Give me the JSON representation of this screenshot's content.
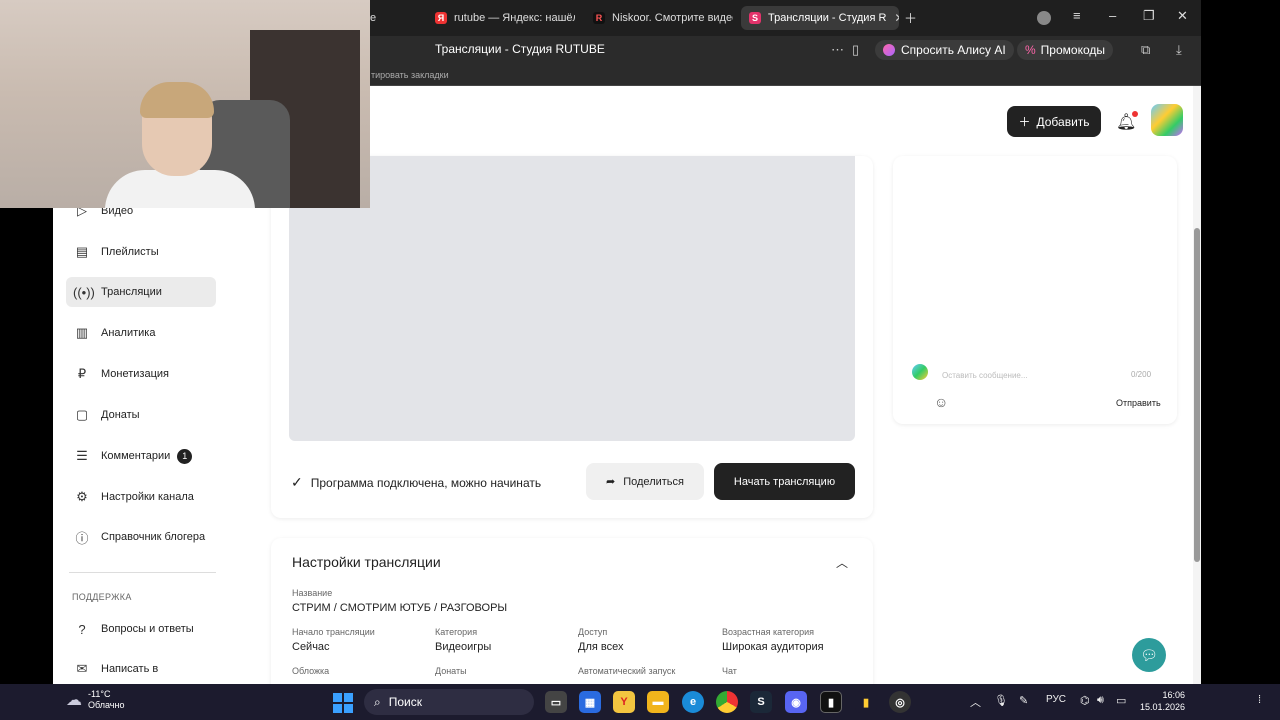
{
  "browser": {
    "tabs": [
      {
        "label": "е",
        "icon": "tab-fragment"
      },
      {
        "label": "rutube — Яндекс: нашёлс",
        "icon": "yandex-icon"
      },
      {
        "label": "Niskoor. Смотрите видео",
        "icon": "rutube-icon"
      },
      {
        "label": "Трансляции - Студия R",
        "icon": "rutube-studio-icon",
        "active": true
      }
    ],
    "address_title": "Трансляции - Студия RUTUBE",
    "alice_label": "Спросить Алису AI",
    "promo_label": "Промокоды",
    "bookmarks_hint": "тировать закладки"
  },
  "header": {
    "add_label": "Добавить"
  },
  "sidebar": {
    "items": [
      {
        "label": "Видео",
        "icon": "video-icon"
      },
      {
        "label": "Плейлисты",
        "icon": "playlist-icon"
      },
      {
        "label": "Трансляции",
        "icon": "broadcast-icon",
        "active": true
      },
      {
        "label": "Аналитика",
        "icon": "analytics-icon"
      },
      {
        "label": "Монетизация",
        "icon": "ruble-icon"
      },
      {
        "label": "Донаты",
        "icon": "donate-icon"
      },
      {
        "label": "Комментарии",
        "icon": "comment-icon",
        "count": "1"
      },
      {
        "label": "Настройки канала",
        "icon": "gear-icon"
      },
      {
        "label": "Справочник блогера",
        "icon": "info-icon"
      }
    ],
    "support_title": "ПОДДЕРЖКА",
    "support_items": [
      {
        "label": "Вопросы и ответы",
        "icon": "help-icon"
      },
      {
        "label": "Написать в",
        "icon": "mail-icon"
      }
    ]
  },
  "stream": {
    "status_text": "Программа подключена, можно начинать",
    "share_label": "Поделиться",
    "start_label": "Начать трансляцию"
  },
  "chat": {
    "placeholder": "Оставить сообщение...",
    "counter": "0/200",
    "send_label": "Отправить"
  },
  "settings": {
    "title": "Настройки трансляции",
    "name_label": "Название",
    "name_value": "СТРИМ / СМОТРИМ ЮТУБ / РАЗГОВОРЫ",
    "fields": [
      {
        "label": "Начало трансляции",
        "value": "Сейчас"
      },
      {
        "label": "Категория",
        "value": "Видеоигры"
      },
      {
        "label": "Доступ",
        "value": "Для всех"
      },
      {
        "label": "Возрастная категория",
        "value": "Широкая аудитория"
      }
    ],
    "fields_row2": [
      {
        "label": "Обложка"
      },
      {
        "label": "Донаты"
      },
      {
        "label": "Автоматический запуск"
      },
      {
        "label": "Чат"
      }
    ]
  },
  "taskbar": {
    "weather_temp": "-11°C",
    "weather_desc": "Облачно",
    "search_label": "Поиск",
    "lang": "РУС",
    "time": "16:06",
    "date": "15.01.2026"
  },
  "colors": {
    "accent_dark": "#222222",
    "help_fab": "#2d9c9c",
    "taskbar": "#1c1b2e"
  }
}
